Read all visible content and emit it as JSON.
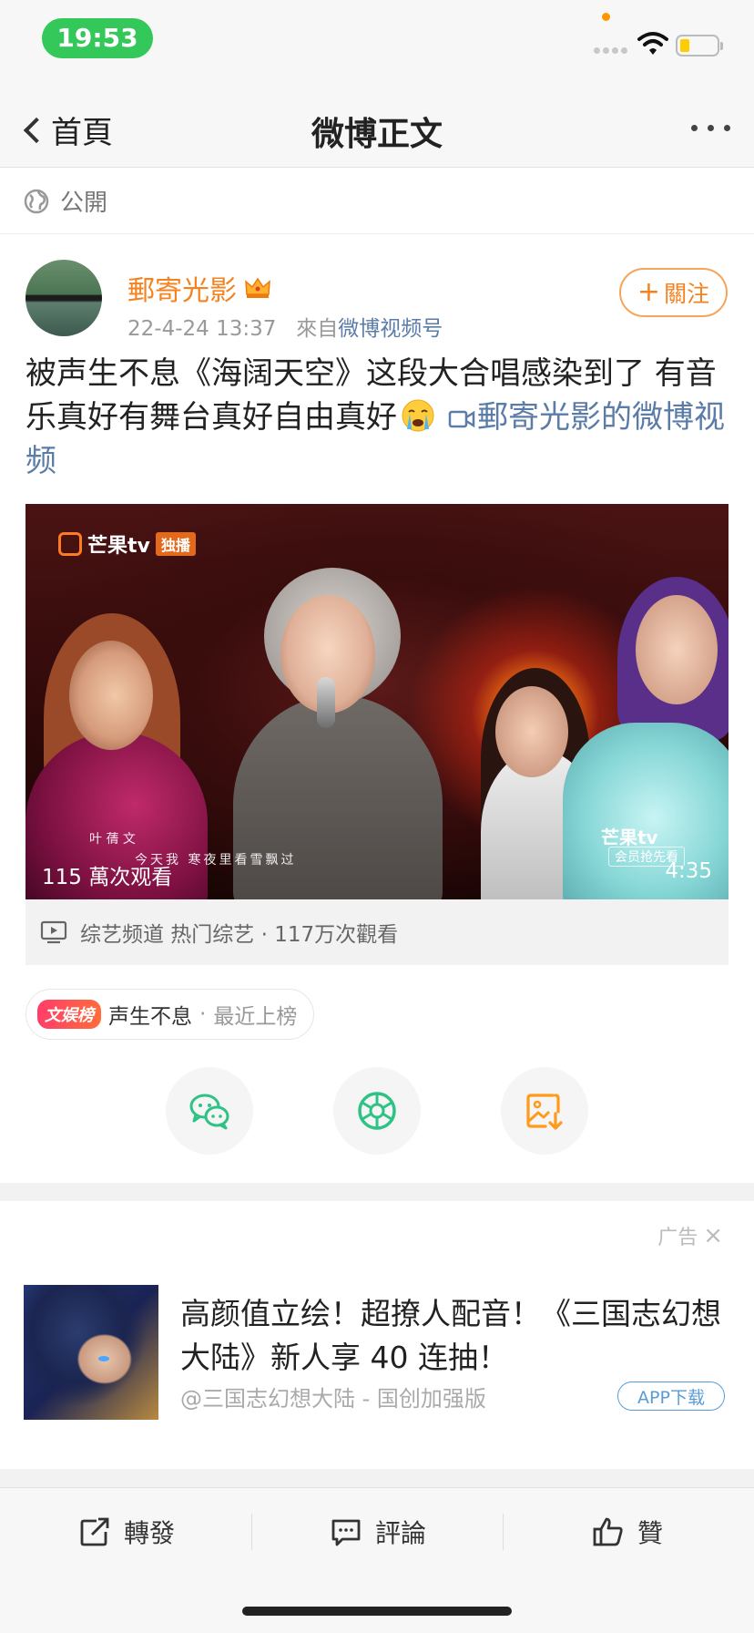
{
  "status_bar": {
    "time": "19:53"
  },
  "nav": {
    "back_label": "首頁",
    "title": "微博正文"
  },
  "visibility": {
    "label": "公開"
  },
  "post": {
    "author": "郵寄光影",
    "date": "22-4-24 13:37",
    "source_prefix": "來自",
    "source": "微博视频号",
    "follow_label": "關注",
    "text_main": "被声生不息《海阔天空》这段大合唱感染到了 有音乐真好有舞台真好自由真好",
    "video_link": "郵寄光影的微博视频"
  },
  "video": {
    "watermark_top": "芒果tv",
    "watermark_badge": "独播",
    "watermark_bottom": "芒果tv",
    "watermark_bottom_badge": "会员抢先看",
    "subtitle_name": "叶 蒨 文",
    "subtitle_lyrics": "今天我 寒夜里看雪飘过",
    "views": "115 萬次观看",
    "duration": "4:35"
  },
  "channel": {
    "text": "综艺频道 热门综艺 · 117万次觀看"
  },
  "topic": {
    "badge": "文娱榜",
    "title": "声生不息",
    "separator": "·",
    "status": "最近上榜"
  },
  "share_buttons": [
    {
      "icon": "wechat-icon"
    },
    {
      "icon": "moments-icon"
    },
    {
      "icon": "save-image-icon"
    }
  ],
  "ad": {
    "label": "广告",
    "close": "×",
    "title": "高颜值立绘！超撩人配音！《三国志幻想大陆》新人享 40 连抽！",
    "source": "@三国志幻想大陆 - 国创加强版",
    "button": "APP下载"
  },
  "bottom_bar": {
    "repost": "轉發",
    "comment": "評論",
    "like": "贊"
  },
  "colors": {
    "accent": "#f5821f",
    "link": "#5b7ca8",
    "status_pill": "#34c759",
    "share_green": "#2ec285",
    "share_orange": "#ff9a1a"
  }
}
